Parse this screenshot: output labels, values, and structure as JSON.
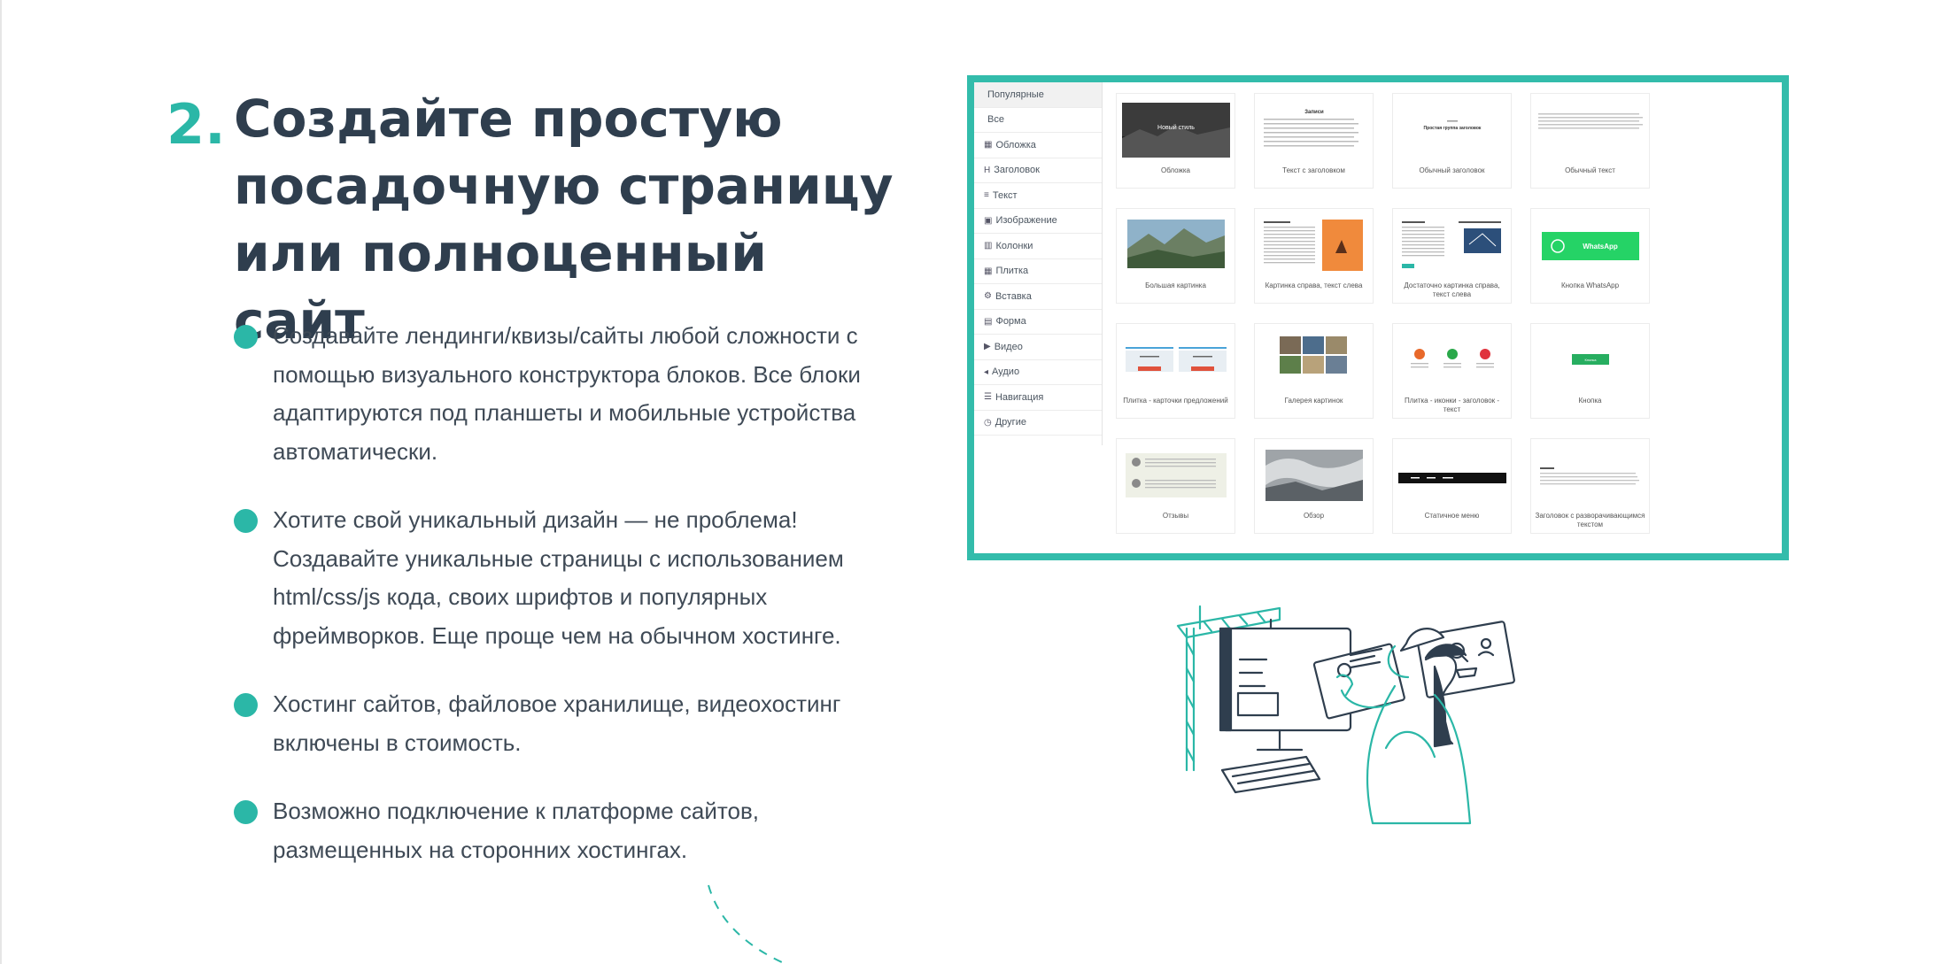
{
  "heading": {
    "number": "2.",
    "title_lines": [
      "Создайте простую",
      "посадочную страницу",
      "или полноценный сайт"
    ]
  },
  "bullets": [
    {
      "text": "Создавайте лендинги/квизы/сайты любой сложности с помощью визуального конструктора блоков. Все блоки адаптируются под планшеты и мобильные устройства автоматически."
    },
    {
      "text": "Хотите свой уникальный дизайн — не проблема! Создавайте уникальные страницы с использованием html/css/js кода, своих шрифтов и популярных фреймворков. Еще проще чем на обычном хостинге."
    },
    {
      "text": "Хостинг сайтов, файловое хранилище, видеохостинг включены в стоимость."
    },
    {
      "text": "Возможно подключение к платформе сайтов, размещенных на сторонних хостингах."
    }
  ],
  "editor": {
    "sidebar": [
      {
        "label": "Популярные",
        "icon": ""
      },
      {
        "label": "Все",
        "icon": ""
      },
      {
        "label": "Обложка",
        "icon": "▦"
      },
      {
        "label": "Заголовок",
        "icon": "H"
      },
      {
        "label": "Текст",
        "icon": "≡"
      },
      {
        "label": "Изображение",
        "icon": "▣"
      },
      {
        "label": "Колонки",
        "icon": "▥"
      },
      {
        "label": "Плитка",
        "icon": "▦"
      },
      {
        "label": "Вставка",
        "icon": "⚙"
      },
      {
        "label": "Форма",
        "icon": "▤"
      },
      {
        "label": "Видео",
        "icon": "▶"
      },
      {
        "label": "Аудио",
        "icon": "◂"
      },
      {
        "label": "Навигация",
        "icon": "☰"
      },
      {
        "label": "Другие",
        "icon": "◷"
      }
    ],
    "cards": [
      {
        "caption": "Обложка",
        "kind": "cover",
        "overlay": "Новый стиль"
      },
      {
        "caption": "Текст с заголовком",
        "kind": "text-title",
        "overlay": "Записи"
      },
      {
        "caption": "Обычный заголовок",
        "kind": "plain-title",
        "overlay": "Простая группа заголовок"
      },
      {
        "caption": "Обычный текст",
        "kind": "plain-text",
        "overlay": ""
      },
      {
        "caption": "Большая картинка",
        "kind": "landscape",
        "overlay": ""
      },
      {
        "caption": "Картинка справа, текст слева",
        "kind": "text-image-right",
        "overlay": ""
      },
      {
        "caption": "Достаточно картинка справа, текст слева",
        "kind": "text-image-small",
        "overlay": ""
      },
      {
        "caption": "Кнопка WhatsApp",
        "kind": "whatsapp",
        "overlay": "WhatsApp"
      },
      {
        "caption": "Плитка - карточки предложений",
        "kind": "offer-tiles",
        "overlay": ""
      },
      {
        "caption": "Галерея картинок",
        "kind": "gallery",
        "overlay": ""
      },
      {
        "caption": "Плитка - иконки - заголовок - текст",
        "kind": "icon-tiles",
        "overlay": ""
      },
      {
        "caption": "Кнопка",
        "kind": "button",
        "overlay": "Кнопка"
      },
      {
        "caption": "Отзывы",
        "kind": "reviews",
        "overlay": ""
      },
      {
        "caption": "Обзор",
        "kind": "cloud",
        "overlay": ""
      },
      {
        "caption": "Статичное меню",
        "kind": "menu",
        "overlay": ""
      },
      {
        "caption": "Заголовок с разворачивающимся текстом",
        "kind": "accordion",
        "overlay": ""
      }
    ]
  },
  "colors": {
    "accent": "#2bb7a7",
    "heading": "#2f3e4e",
    "body_text": "#3f4a56",
    "frame": "#33bcab",
    "whatsapp": "#25d366"
  }
}
